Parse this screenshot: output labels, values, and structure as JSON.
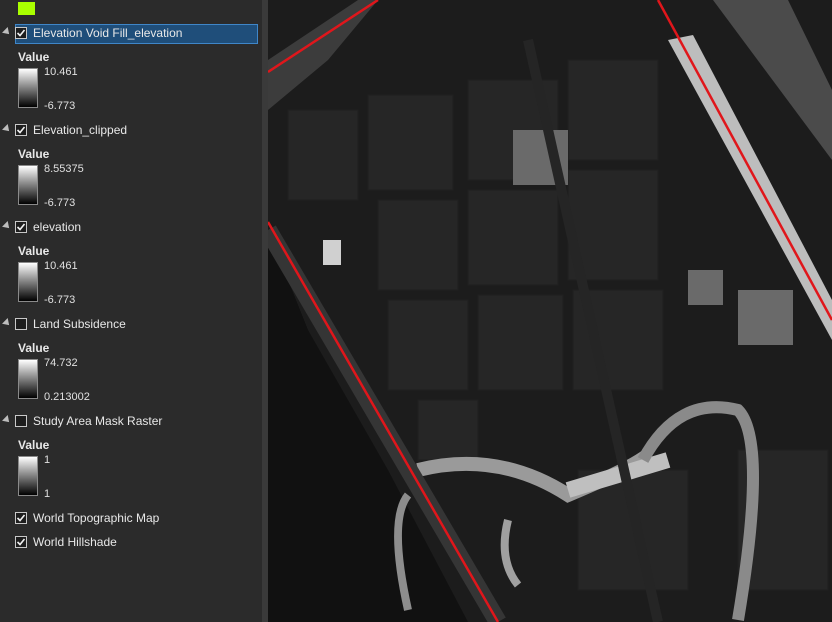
{
  "toc": {
    "top_swatch_color": "#aaff00",
    "layers": [
      {
        "name": "Elevation Void Fill_elevation",
        "checked": true,
        "selected": true,
        "legend": {
          "title": "Value",
          "max": "10.461",
          "min": "-6.773"
        }
      },
      {
        "name": "Elevation_clipped",
        "checked": true,
        "selected": false,
        "legend": {
          "title": "Value",
          "max": "8.55375",
          "min": "-6.773"
        }
      },
      {
        "name": "elevation",
        "checked": true,
        "selected": false,
        "legend": {
          "title": "Value",
          "max": "10.461",
          "min": "-6.773"
        }
      },
      {
        "name": "Land Subsidence",
        "checked": false,
        "selected": false,
        "legend": {
          "title": "Value",
          "max": "74.732",
          "min": "0.213002"
        }
      },
      {
        "name": "Study Area Mask Raster",
        "checked": false,
        "selected": false,
        "legend": {
          "title": "Value",
          "max": "1",
          "min": "1"
        }
      },
      {
        "name": "World Topographic Map",
        "checked": true,
        "selected": false
      },
      {
        "name": "World Hillshade",
        "checked": true,
        "selected": false
      }
    ]
  },
  "map": {
    "boundary_color": "#e0161b",
    "background_color": "#1c1c1c"
  }
}
